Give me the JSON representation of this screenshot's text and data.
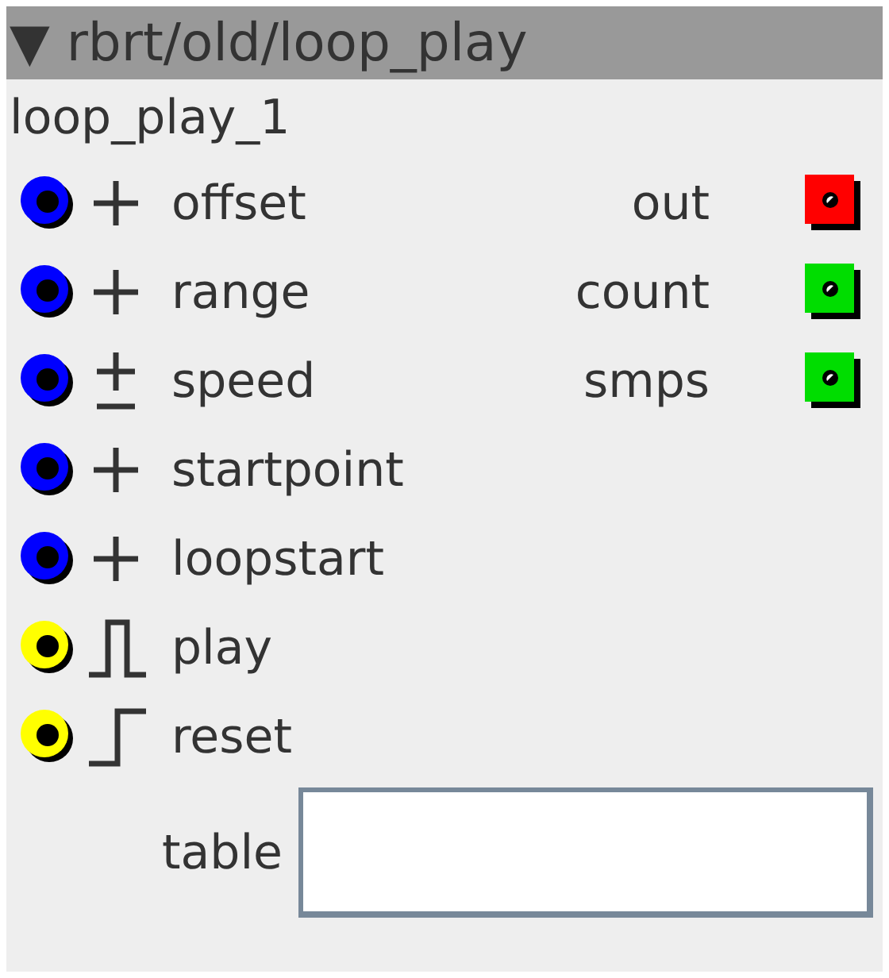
{
  "window": {
    "title": "▼ rbrt/old/loop_play"
  },
  "node": {
    "name": "loop_play_1"
  },
  "inputs": [
    {
      "label": "offset",
      "kind": "plus",
      "color": "#0000ff"
    },
    {
      "label": "range",
      "kind": "plus",
      "color": "#0000ff"
    },
    {
      "label": "speed",
      "kind": "plusminus",
      "color": "#0000ff"
    },
    {
      "label": "startpoint",
      "kind": "plus",
      "color": "#0000ff"
    },
    {
      "label": "loopstart",
      "kind": "plus",
      "color": "#0000ff"
    },
    {
      "label": "play",
      "kind": "pulse",
      "color": "#ffff00"
    },
    {
      "label": "reset",
      "kind": "step",
      "color": "#ffff00"
    }
  ],
  "outputs": [
    {
      "label": "out",
      "color": "#ff0000"
    },
    {
      "label": "count",
      "color": "#00dd00"
    },
    {
      "label": "smps",
      "color": "#00dd00"
    }
  ],
  "table": {
    "label": "table"
  }
}
